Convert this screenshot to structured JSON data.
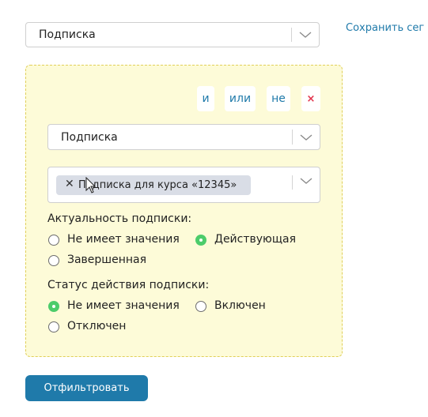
{
  "top_select": {
    "value": "Подписка"
  },
  "save_segment_label": "Сохранить сег",
  "group": {
    "operators": {
      "and": "и",
      "or": "или",
      "not": "не",
      "remove": "×"
    },
    "field_select": {
      "value": "Подписка"
    },
    "tag_select": {
      "tag_label": "Подписка для курса «12345»",
      "tag_remove": "✕"
    },
    "relevance": {
      "label": "Актуальность подписки:",
      "options": [
        {
          "label": "Не имеет значения",
          "checked": false
        },
        {
          "label": "Действующая",
          "checked": true
        },
        {
          "label": "Завершенная",
          "checked": false
        }
      ]
    },
    "status": {
      "label": "Статус действия подписки:",
      "options": [
        {
          "label": "Не имеет значения",
          "checked": true
        },
        {
          "label": "Включен",
          "checked": false
        },
        {
          "label": "Отключен",
          "checked": false
        }
      ]
    }
  },
  "filter_button_label": "Отфильтровать",
  "colors": {
    "accent": "#1f7aaa",
    "group_background": "#fdfbd8",
    "group_border": "#e0cf58",
    "radio_checked": "#4ccc6a",
    "remove": "#e2334b",
    "tag_background": "#d9dde6"
  }
}
